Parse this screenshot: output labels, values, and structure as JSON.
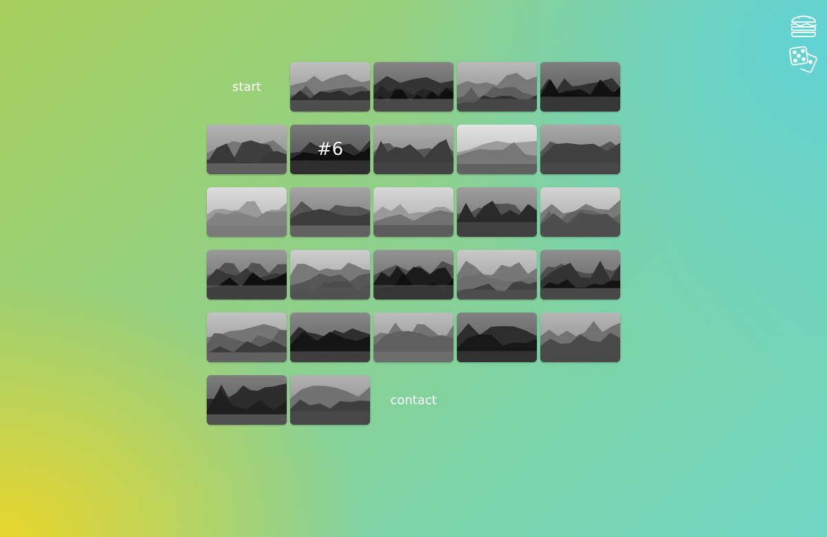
{
  "nav": {
    "start_label": "start",
    "contact_label": "contact"
  },
  "icons": {
    "top": "burger-icon",
    "bottom": "dice-icon"
  },
  "colors": {
    "gradient_yellow": "#e8d62c",
    "gradient_green": "#8fd08c",
    "gradient_cyan": "#60d2d7"
  },
  "tiles": [
    {
      "scene": "lake-mountain"
    },
    {
      "scene": "forest-trees"
    },
    {
      "scene": "valley-mist"
    },
    {
      "scene": "coastal-town"
    },
    {
      "scene": "rooftop-tiles"
    },
    {
      "scene": "sunset-lake",
      "label": "#6"
    },
    {
      "scene": "clouds-boat"
    },
    {
      "scene": "foggy-slope"
    },
    {
      "scene": "mountain-gorge"
    },
    {
      "scene": "old-window"
    },
    {
      "scene": "lake-hills"
    },
    {
      "scene": "harbor-masts"
    },
    {
      "scene": "boat-water"
    },
    {
      "scene": "lake-town"
    },
    {
      "scene": "storm-lake"
    },
    {
      "scene": "boathouse"
    },
    {
      "scene": "misty-ranges"
    },
    {
      "scene": "hill-lake"
    },
    {
      "scene": "town-aerial"
    },
    {
      "scene": "pier-dusk"
    },
    {
      "scene": "alpine-lake"
    },
    {
      "scene": "hilltop-village"
    },
    {
      "scene": "calm-shore"
    },
    {
      "scene": "cloudy-valley"
    },
    {
      "scene": "willow-lake"
    },
    {
      "scene": "castle-night"
    }
  ]
}
